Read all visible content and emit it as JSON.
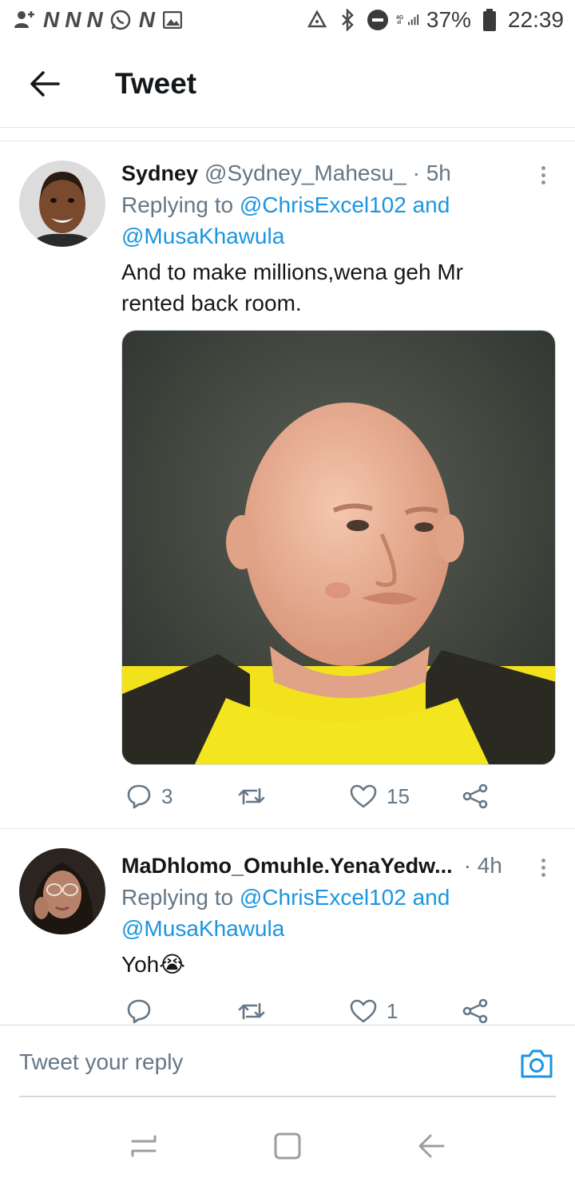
{
  "status_bar": {
    "notification_letters": [
      "N",
      "N",
      "N",
      "N"
    ],
    "battery": "37%",
    "network": "4G",
    "time": "22:39",
    "icons": [
      "add-user-icon",
      "whatsapp-icon",
      "gallery-icon",
      "recycle-icon",
      "bluetooth-icon",
      "do-not-disturb-icon",
      "signal-icon",
      "battery-icon"
    ]
  },
  "header": {
    "title": "Tweet",
    "back_icon": "arrow-left-icon"
  },
  "tweets": [
    {
      "name": "Sydney",
      "handle": "@Sydney_Mahesu_",
      "time": "· 5h",
      "replying_prefix": "Replying to",
      "replying_to_1": "@ChrisExcel102",
      "replying_and": "and",
      "replying_to_2": "@MusaKhawula",
      "text_line1": "And to make millions,wena geh Mr",
      "text_line2": "rented back room.",
      "replies": "3",
      "retweets": "",
      "likes": "15"
    },
    {
      "name": "MaDhlomo_Omuhle.YenaYedw...",
      "handle": "",
      "time": "· 4h",
      "replying_prefix": "Replying to",
      "replying_to_1": "@ChrisExcel102",
      "replying_and": "and",
      "replying_to_2": "@MusaKhawula",
      "text": "Yoh",
      "text_emoji": "😭",
      "replies": "",
      "retweets": "",
      "likes": "1"
    }
  ],
  "composer": {
    "placeholder": "Tweet your reply"
  },
  "colors": {
    "accent": "#1b95e0",
    "secondary_text": "#657786",
    "primary_text": "#14171a"
  }
}
